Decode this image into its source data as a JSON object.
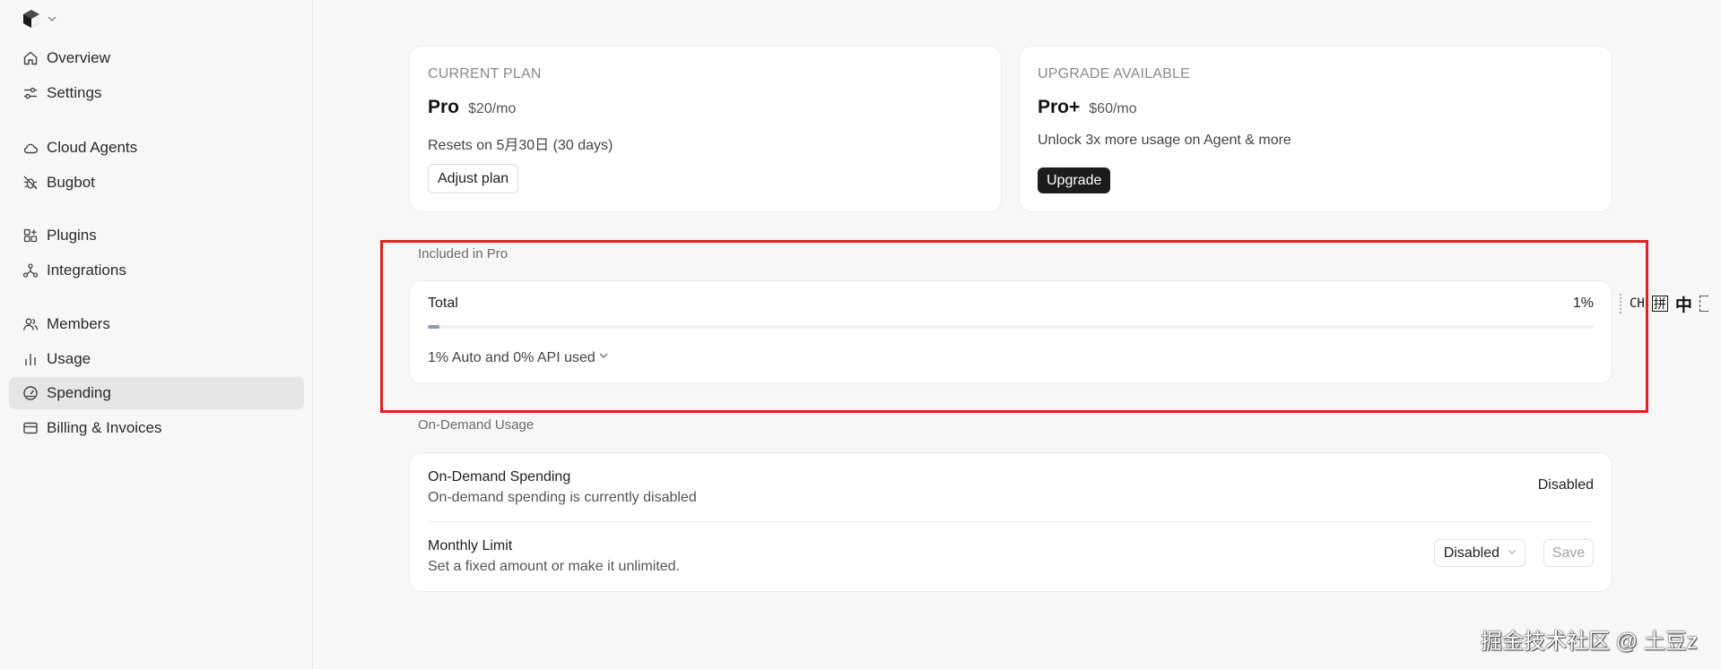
{
  "sidebar": {
    "items": [
      {
        "id": "overview",
        "label": "Overview",
        "icon": "home-icon"
      },
      {
        "id": "settings",
        "label": "Settings",
        "icon": "sliders-icon"
      },
      {
        "id": "cloud-agents",
        "label": "Cloud Agents",
        "icon": "cloud-icon"
      },
      {
        "id": "bugbot",
        "label": "Bugbot",
        "icon": "bug-off-icon"
      },
      {
        "id": "plugins",
        "label": "Plugins",
        "icon": "grid-plus-icon"
      },
      {
        "id": "integrations",
        "label": "Integrations",
        "icon": "share-nodes-icon"
      },
      {
        "id": "members",
        "label": "Members",
        "icon": "users-icon"
      },
      {
        "id": "usage",
        "label": "Usage",
        "icon": "bar-chart-icon"
      },
      {
        "id": "spending",
        "label": "Spending",
        "icon": "gauge-icon",
        "active": true
      },
      {
        "id": "billing",
        "label": "Billing & Invoices",
        "icon": "card-icon"
      }
    ]
  },
  "current_plan": {
    "label": "CURRENT PLAN",
    "name": "Pro",
    "price": "$20/mo",
    "description": "Resets on 5月30日 (30 days)",
    "button": "Adjust plan"
  },
  "upgrade": {
    "label": "UPGRADE AVAILABLE",
    "name": "Pro+",
    "price": "$60/mo",
    "description": "Unlock 3x more usage on Agent & more",
    "button": "Upgrade"
  },
  "included": {
    "section_label": "Included in Pro",
    "total_label": "Total",
    "total_percent_text": "1%",
    "progress_fraction": 0.01,
    "detail": "1% Auto and 0% API used"
  },
  "on_demand": {
    "section_label": "On-Demand Usage",
    "spending_title": "On-Demand Spending",
    "spending_sub": "On-demand spending is currently disabled",
    "spending_status": "Disabled",
    "limit_title": "Monthly Limit",
    "limit_sub": "Set a fixed amount or make it unlimited.",
    "limit_select_value": "Disabled",
    "save_label": "Save"
  },
  "ime": {
    "en": "CH",
    "pinyin": "拼",
    "zh": "中"
  },
  "watermark": "掘金技术社区 @ 土豆z",
  "colors": {
    "highlight": "#e0211e",
    "progress": "#8e99b8",
    "active_nav": "#e6e6e6",
    "dark_button": "#1c1c1c"
  }
}
